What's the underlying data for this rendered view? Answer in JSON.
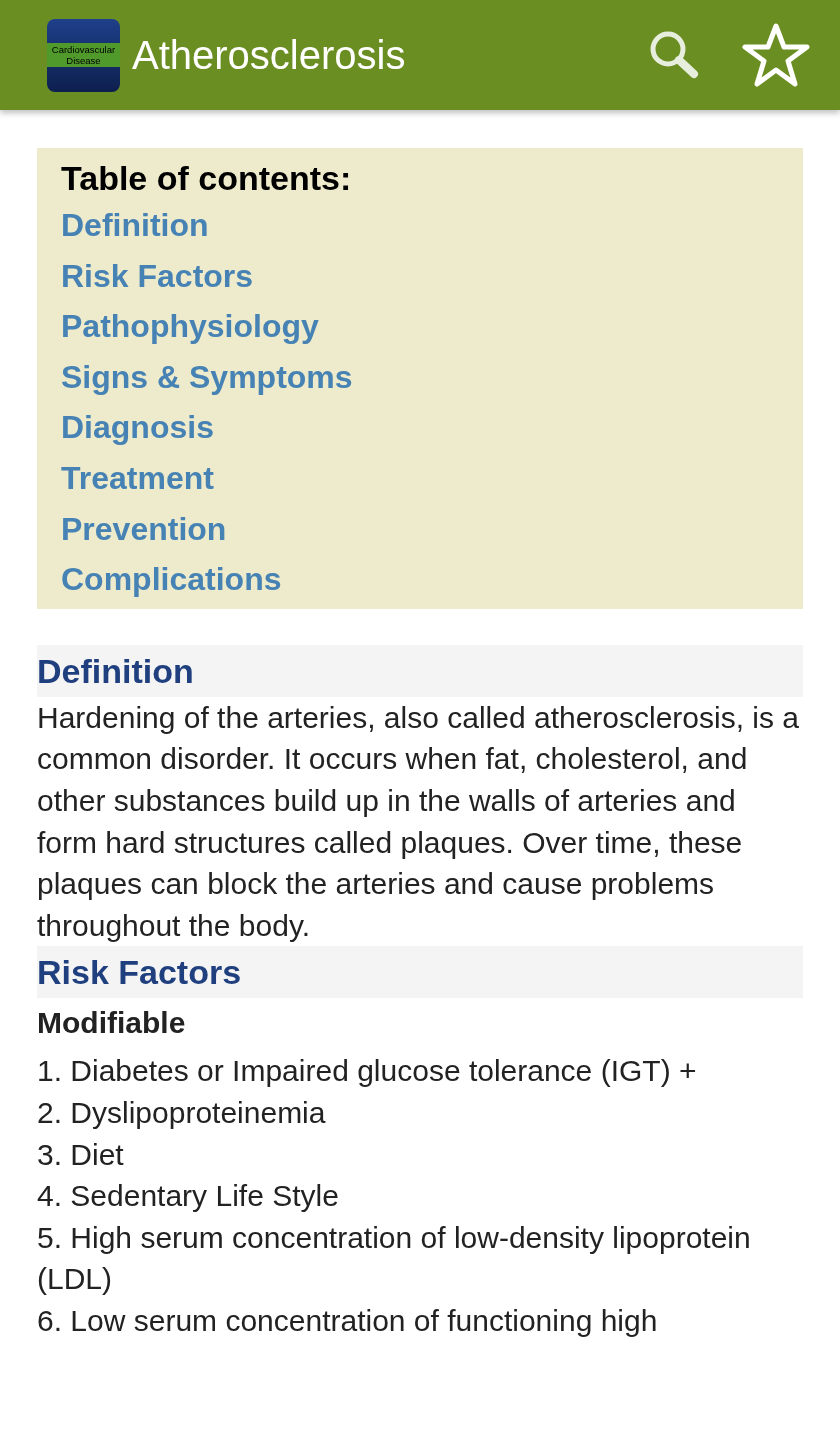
{
  "app_bar": {
    "icon_text": [
      "Cardiovascular",
      "Disease"
    ],
    "title": "Atherosclerosis"
  },
  "toc": {
    "title": "Table of contents:",
    "links": [
      "Definition",
      "Risk Factors",
      "Pathophysiology",
      "Signs & Symptoms",
      "Diagnosis",
      "Treatment",
      "Prevention",
      "Complications"
    ]
  },
  "sections": [
    {
      "title": "Definition",
      "blocks": [
        {
          "kind": "paragraph",
          "text": "Hardening of the arteries, also called atherosclerosis, is a common disorder. It occurs when fat, cholesterol, and other substances build up in the walls of arteries and form hard structures called plaques. Over time, these plaques can block the arteries and cause problems throughout the body."
        }
      ]
    },
    {
      "title": "Risk Factors",
      "blocks": [
        {
          "kind": "subheading",
          "text": "Modifiable"
        },
        {
          "kind": "list",
          "items": [
            "1. Diabetes or Impaired glucose tolerance (IGT) +",
            "2. Dyslipoproteinemia",
            "3. Diet",
            "4. Sedentary Life Style",
            "5. High serum concentration of low-density lipoprotein (LDL)",
            "6. Low serum concentration of functioning high"
          ]
        }
      ]
    }
  ]
}
